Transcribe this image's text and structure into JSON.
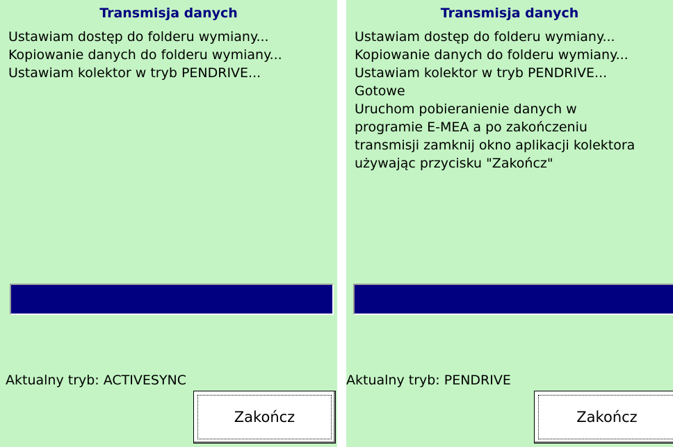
{
  "screens": [
    {
      "title": "Transmisja danych",
      "log_lines": [
        "Ustawiam dostęp do folderu wymiany...",
        "Kopiowanie danych do folderu wymiany...",
        "Ustawiam kolektor w tryb PENDRIVE..."
      ],
      "progress_fraction": 1.0,
      "mode_text": "Aktualny tryb: ACTIVESYNC",
      "finish_button_label": "Zakończ"
    },
    {
      "title": "Transmisja danych",
      "log_lines": [
        "Ustawiam dostęp do folderu wymiany...",
        "Kopiowanie danych do folderu wymiany...",
        "Ustawiam kolektor w tryb PENDRIVE...",
        "Gotowe",
        "Uruchom pobieranienie danych w",
        "programie E-MEA a po zakończeniu",
        "transmisji zamknij okno aplikacji kolektora",
        "używając przycisku \"Zakończ\""
      ],
      "progress_fraction": 1.0,
      "mode_text": "Aktualny tryb: PENDRIVE",
      "finish_button_label": "Zakończ"
    }
  ],
  "colors": {
    "background": "#c4f4c4",
    "title": "#000080",
    "progress_fill": "#000080",
    "button_face": "#ffffff"
  }
}
